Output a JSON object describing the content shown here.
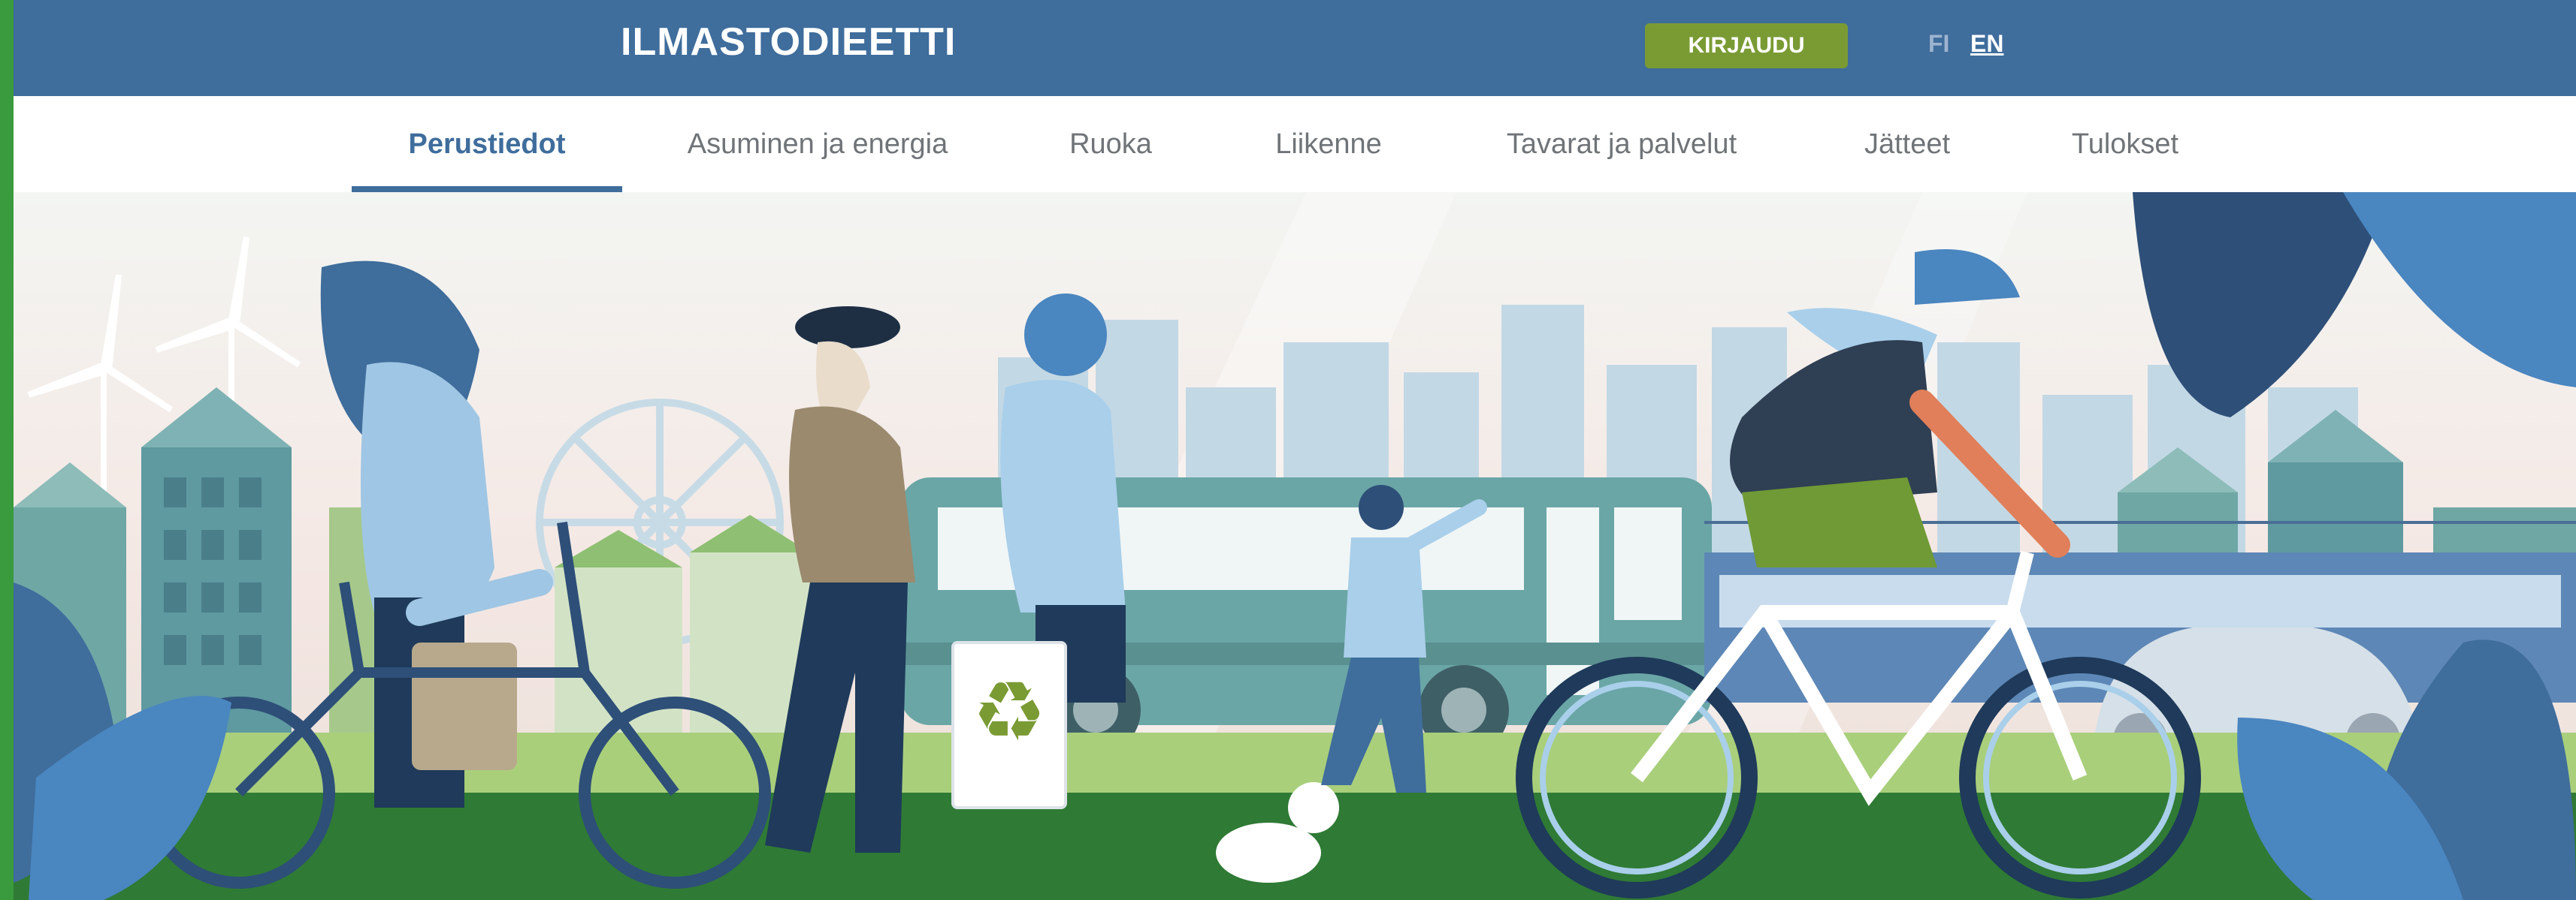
{
  "header": {
    "brand": "ILMASTODIEETTI",
    "login_label": "KIRJAUDU",
    "languages": [
      "FI",
      "EN"
    ],
    "active_language": "EN"
  },
  "nav": {
    "tabs": [
      {
        "label": "Perustiedot",
        "active": true
      },
      {
        "label": "Asuminen ja energia",
        "active": false
      },
      {
        "label": "Ruoka",
        "active": false
      },
      {
        "label": "Liikenne",
        "active": false
      },
      {
        "label": "Tavarat ja palvelut",
        "active": false
      },
      {
        "label": "Jätteet",
        "active": false
      },
      {
        "label": "Tulokset",
        "active": false
      }
    ]
  },
  "colors": {
    "header_bg": "#3f6d9c",
    "login_button": "#7a9b34",
    "accent_strip": "#3a9a3e",
    "active_tab": "#3f6d9c"
  },
  "hero": {
    "scene": "illustration",
    "icons": [
      "recycle-icon"
    ]
  }
}
